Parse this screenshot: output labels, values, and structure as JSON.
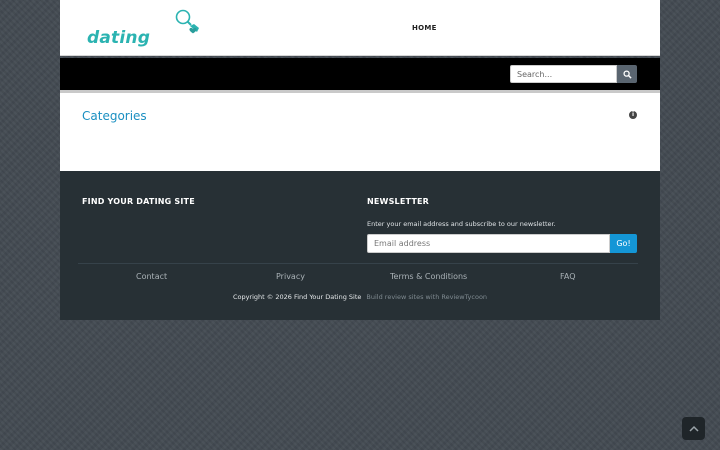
{
  "header": {
    "logo_text": "dating",
    "nav": [
      {
        "label": "HOME"
      }
    ]
  },
  "search": {
    "placeholder": "Search...",
    "button_icon": "search-icon"
  },
  "categories": {
    "title": "Categories",
    "info_icon": "info-icon"
  },
  "footer": {
    "left_heading": "FIND YOUR DATING SITE",
    "newsletter": {
      "heading": "NEWSLETTER",
      "description": "Enter your email address and subscribe to our newsletter.",
      "email_placeholder": "Email address",
      "button_label": "Go!"
    },
    "links": [
      {
        "label": "Contact"
      },
      {
        "label": "Privacy"
      },
      {
        "label": "Terms & Conditions"
      },
      {
        "label": "FAQ"
      }
    ],
    "copyright": "Copyright © 2026 Find Your Dating Site",
    "credit": "Build review sites with ReviewTycoon"
  },
  "scroll_top": {
    "icon": "chevron-up-icon"
  },
  "colors": {
    "logo_teal": "#2bb3b1",
    "link_blue": "#1a8fc1",
    "go_button": "#1496d6",
    "footer_bg": "#273035",
    "page_bg": "#434a52"
  }
}
